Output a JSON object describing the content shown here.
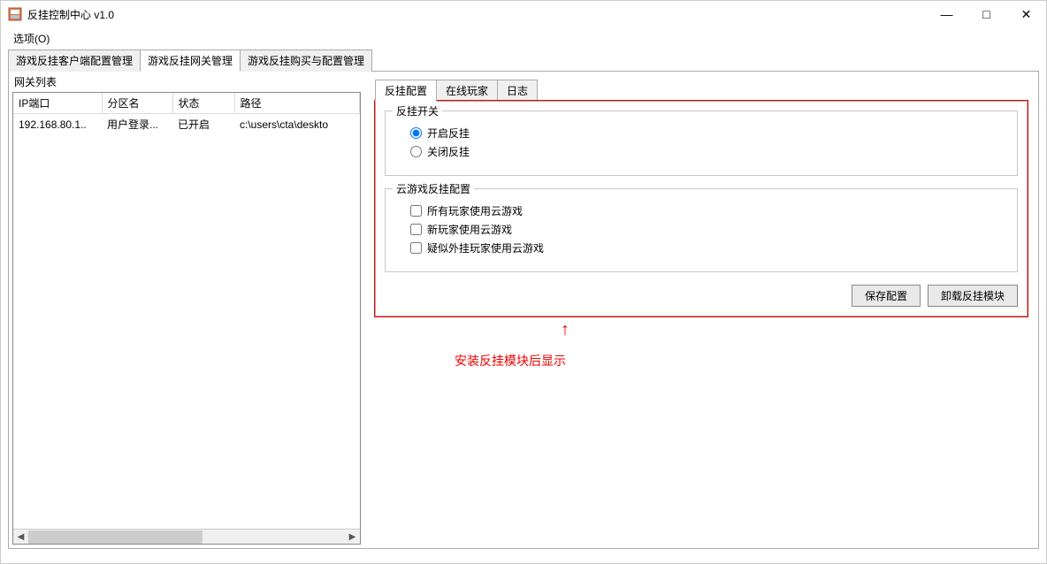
{
  "window": {
    "title": "反挂控制中心 v1.0"
  },
  "menu": {
    "options": "选项(O)"
  },
  "main_tabs": [
    {
      "label": "游戏反挂客户端配置管理",
      "active": false
    },
    {
      "label": "游戏反挂网关管理",
      "active": true
    },
    {
      "label": "游戏反挂购买与配置管理",
      "active": false
    }
  ],
  "left": {
    "title": "网关列表",
    "columns": [
      "IP端口",
      "分区名",
      "状态",
      "路径"
    ],
    "rows": [
      {
        "ip": "192.168.80.1..",
        "zone": "用户登录...",
        "status": "已开启",
        "path": "c:\\users\\cta\\deskto"
      }
    ]
  },
  "sub_tabs": [
    {
      "label": "反挂配置",
      "active": true
    },
    {
      "label": "在线玩家",
      "active": false
    },
    {
      "label": "日志",
      "active": false
    }
  ],
  "switch_group": {
    "title": "反挂开关",
    "options": [
      {
        "label": "开启反挂",
        "checked": true
      },
      {
        "label": "关闭反挂",
        "checked": false
      }
    ]
  },
  "cloud_group": {
    "title": "云游戏反挂配置",
    "options": [
      {
        "label": "所有玩家使用云游戏",
        "checked": false
      },
      {
        "label": "新玩家使用云游戏",
        "checked": false
      },
      {
        "label": "疑似外挂玩家使用云游戏",
        "checked": false
      }
    ]
  },
  "buttons": {
    "save": "保存配置",
    "unload": "卸载反挂模块"
  },
  "annotation": "安装反挂模块后显示"
}
